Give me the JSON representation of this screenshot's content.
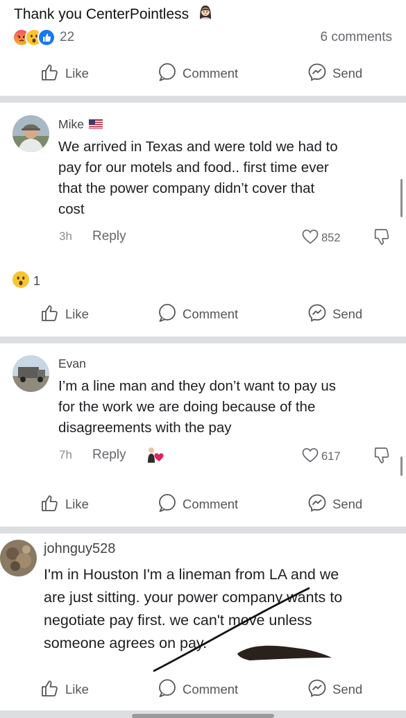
{
  "post": {
    "caption": "Thank you CenterPointless",
    "reaction_count": "22",
    "comments_count": "6 comments"
  },
  "actions": {
    "like": "Like",
    "comment": "Comment",
    "send": "Send"
  },
  "comments": [
    {
      "author": "Mike",
      "text_lines": [
        "We arrived in Texas and were told we had to",
        "pay for our motels and food.. first time ever",
        "that the power company didn’t cover that",
        "cost"
      ],
      "time": "3h",
      "reply": "Reply",
      "upvotes": "852",
      "reaction_count": "1"
    },
    {
      "author": "Evan",
      "text_lines": [
        "I’m a line man and they don’t want to pay us",
        "for the work we are doing because of the",
        "disagreements with the pay"
      ],
      "time": "7h",
      "reply": "Reply",
      "upvotes": "617"
    },
    {
      "author": "johnguy528",
      "text_lines": [
        "I'm in Houston I'm a lineman from LA and we",
        "are just sitting. your power company wants to",
        "negotiate pay first. we can't move unless",
        "someone agrees on pay."
      ]
    }
  ],
  "colors": {
    "like_blue": "#1877f2",
    "angry_red": "#e9710f",
    "divider": "#dcdee2",
    "muted": "#65676b"
  },
  "icons": [
    "angry-reaction-icon",
    "wow-reaction-icon",
    "like-reaction-icon",
    "thumbs-up-icon",
    "comment-bubble-icon",
    "messenger-icon",
    "heart-outline-icon",
    "downvote-icon"
  ]
}
